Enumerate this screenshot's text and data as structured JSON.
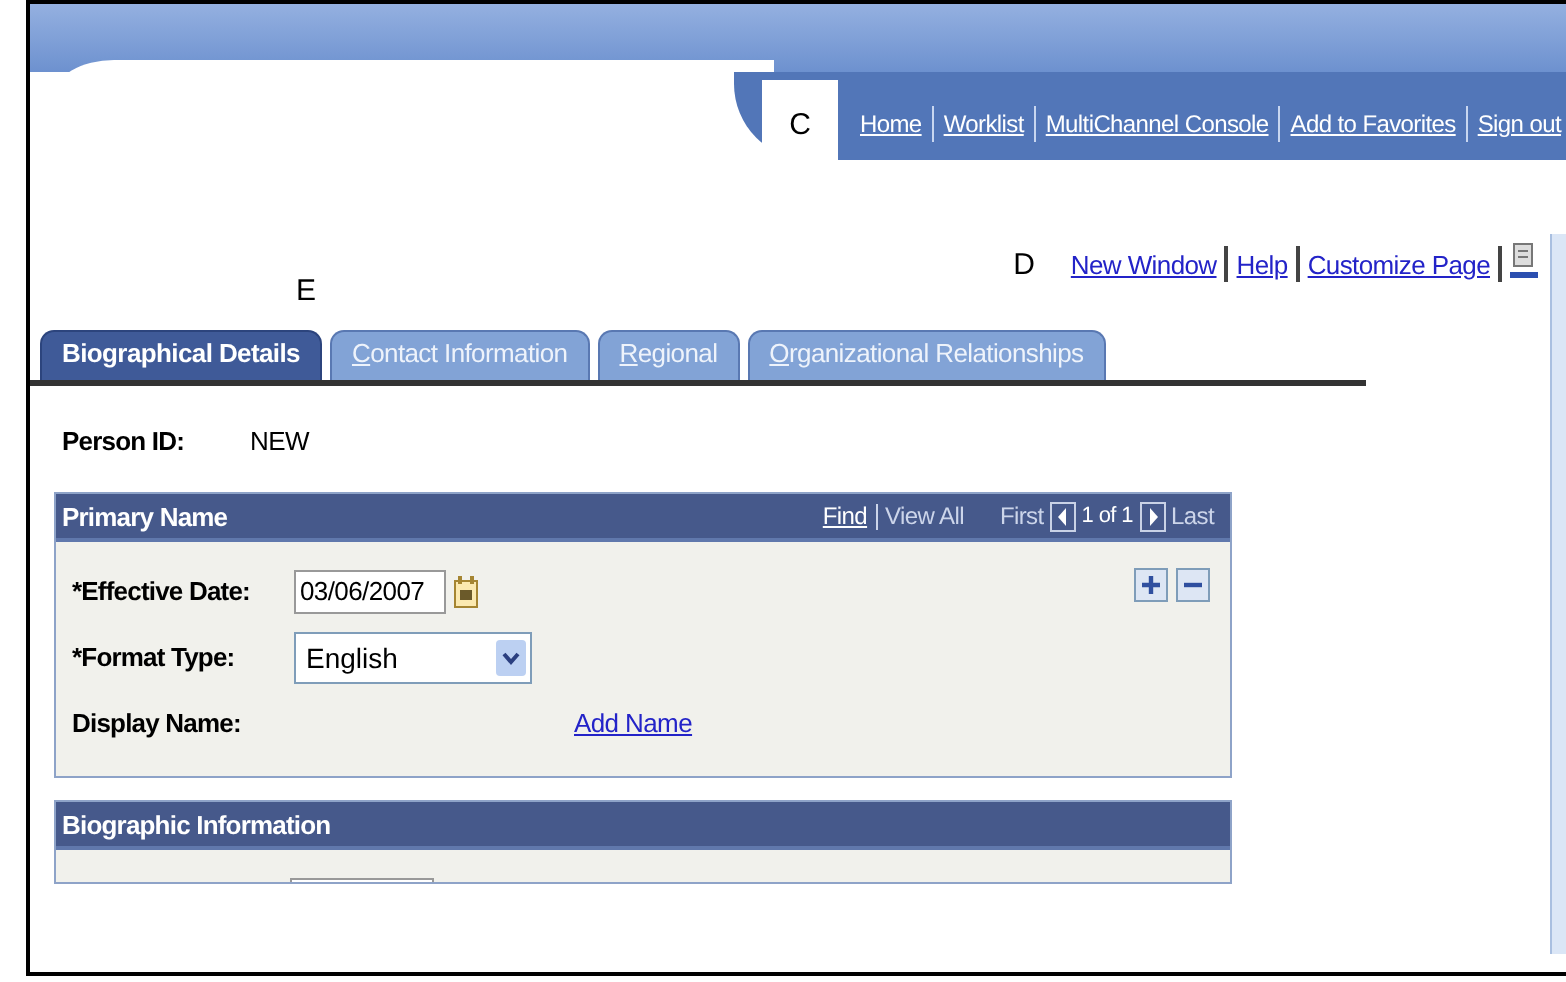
{
  "banner": {
    "callout": "C",
    "links": [
      {
        "label": "Home"
      },
      {
        "label": "Worklist"
      },
      {
        "label": "MultiChannel Console"
      },
      {
        "label": "Add to Favorites"
      },
      {
        "label": "Sign out"
      }
    ]
  },
  "page_links": {
    "callout": "D",
    "links": [
      {
        "label": "New Window"
      },
      {
        "label": "Help"
      },
      {
        "label": "Customize Page"
      }
    ]
  },
  "tabs_callout": "E",
  "tabs": [
    {
      "label": "Biographical Details",
      "selected": true
    },
    {
      "label": "Contact Information",
      "selected": false
    },
    {
      "label": "Regional",
      "selected": false
    },
    {
      "label": "Organizational Relationships",
      "selected": false
    }
  ],
  "person_id": {
    "label": "Person ID:",
    "value": "NEW"
  },
  "primary_name": {
    "title": "Primary Name",
    "find": "Find",
    "view_all": "View All",
    "first": "First",
    "count": "1 of 1",
    "last": "Last",
    "fields": [
      {
        "kind": "date",
        "label": "*Effective Date:",
        "value": "03/06/2007"
      },
      {
        "kind": "select",
        "label": "*Format Type:",
        "value": "English"
      },
      {
        "kind": "link",
        "label": "Display Name:",
        "value": "Add Name"
      }
    ]
  },
  "biographic": {
    "title": "Biographic Information"
  }
}
